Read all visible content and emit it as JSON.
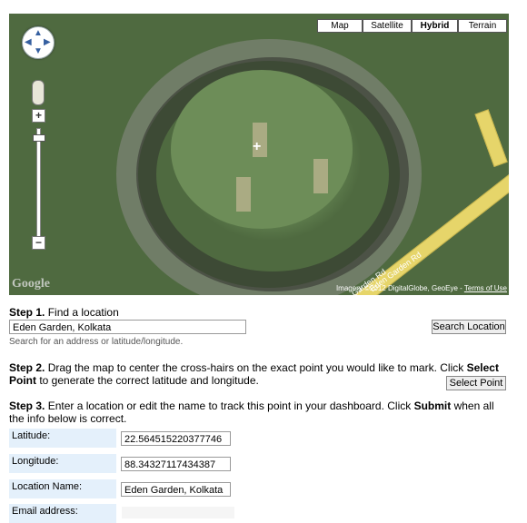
{
  "map": {
    "types": [
      {
        "label": "Map",
        "active": false
      },
      {
        "label": "Satellite",
        "active": false
      },
      {
        "label": "Hybrid",
        "active": true
      },
      {
        "label": "Terrain",
        "active": false
      }
    ],
    "pan_arrows": {
      "up": "▲",
      "left": "◀",
      "right": "▶",
      "down": "▼"
    },
    "zoom_in": "+",
    "zoom_out": "−",
    "crosshair": "+",
    "logo": "Google",
    "road_label_1": "Garden Rd",
    "road_label_2": "Eden Garden Rd",
    "imagery": "Imagery ©2012 DigitalGlobe, GeoEye - ",
    "terms": "Terms of Use"
  },
  "step1": {
    "title": "Step 1.",
    "text": " Find a location",
    "input_value": "Eden Garden, Kolkata",
    "button": "Search Location",
    "hint": "Search for an address or latitude/longitude."
  },
  "step2": {
    "title": "Step 2.",
    "text_a": " Drag the map to center the cross-hairs on the exact point you would like to mark. Click ",
    "bold": "Select Point",
    "text_b": " to generate the correct latitude and longitude.",
    "button": "Select Point"
  },
  "step3": {
    "title": "Step 3.",
    "text_a": " Enter a location or edit the name to track this point in your dashboard. Click ",
    "bold": "Submit",
    "text_b": " when all the info below is correct."
  },
  "form": {
    "latitude_label": "Latitude:",
    "latitude_value": "22.564515220377746",
    "longitude_label": "Longitude:",
    "longitude_value": "88.34327117434387",
    "location_label": "Location Name:",
    "location_value": "Eden Garden, Kolkata",
    "email_label": "Email address:"
  }
}
